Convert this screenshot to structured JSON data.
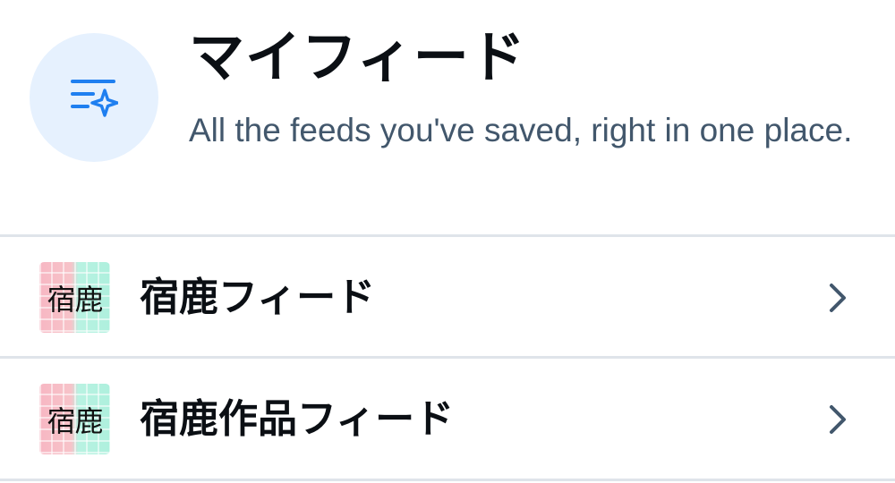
{
  "header": {
    "icon": "feed-sparkle-icon",
    "title": "マイフィード",
    "subtitle": "All the feeds you've saved, right in one place."
  },
  "colors": {
    "accent": "#1f7ff0",
    "icon_bg": "#e6f1fe",
    "subtitle": "#42576c",
    "divider": "#dfe4ea",
    "chevron": "#42576c"
  },
  "feeds": [
    {
      "avatar_text": "宿鹿",
      "name": "宿鹿フィード",
      "chevron_icon": "chevron-right-icon"
    },
    {
      "avatar_text": "宿鹿",
      "name": "宿鹿作品フィード",
      "chevron_icon": "chevron-right-icon"
    }
  ]
}
